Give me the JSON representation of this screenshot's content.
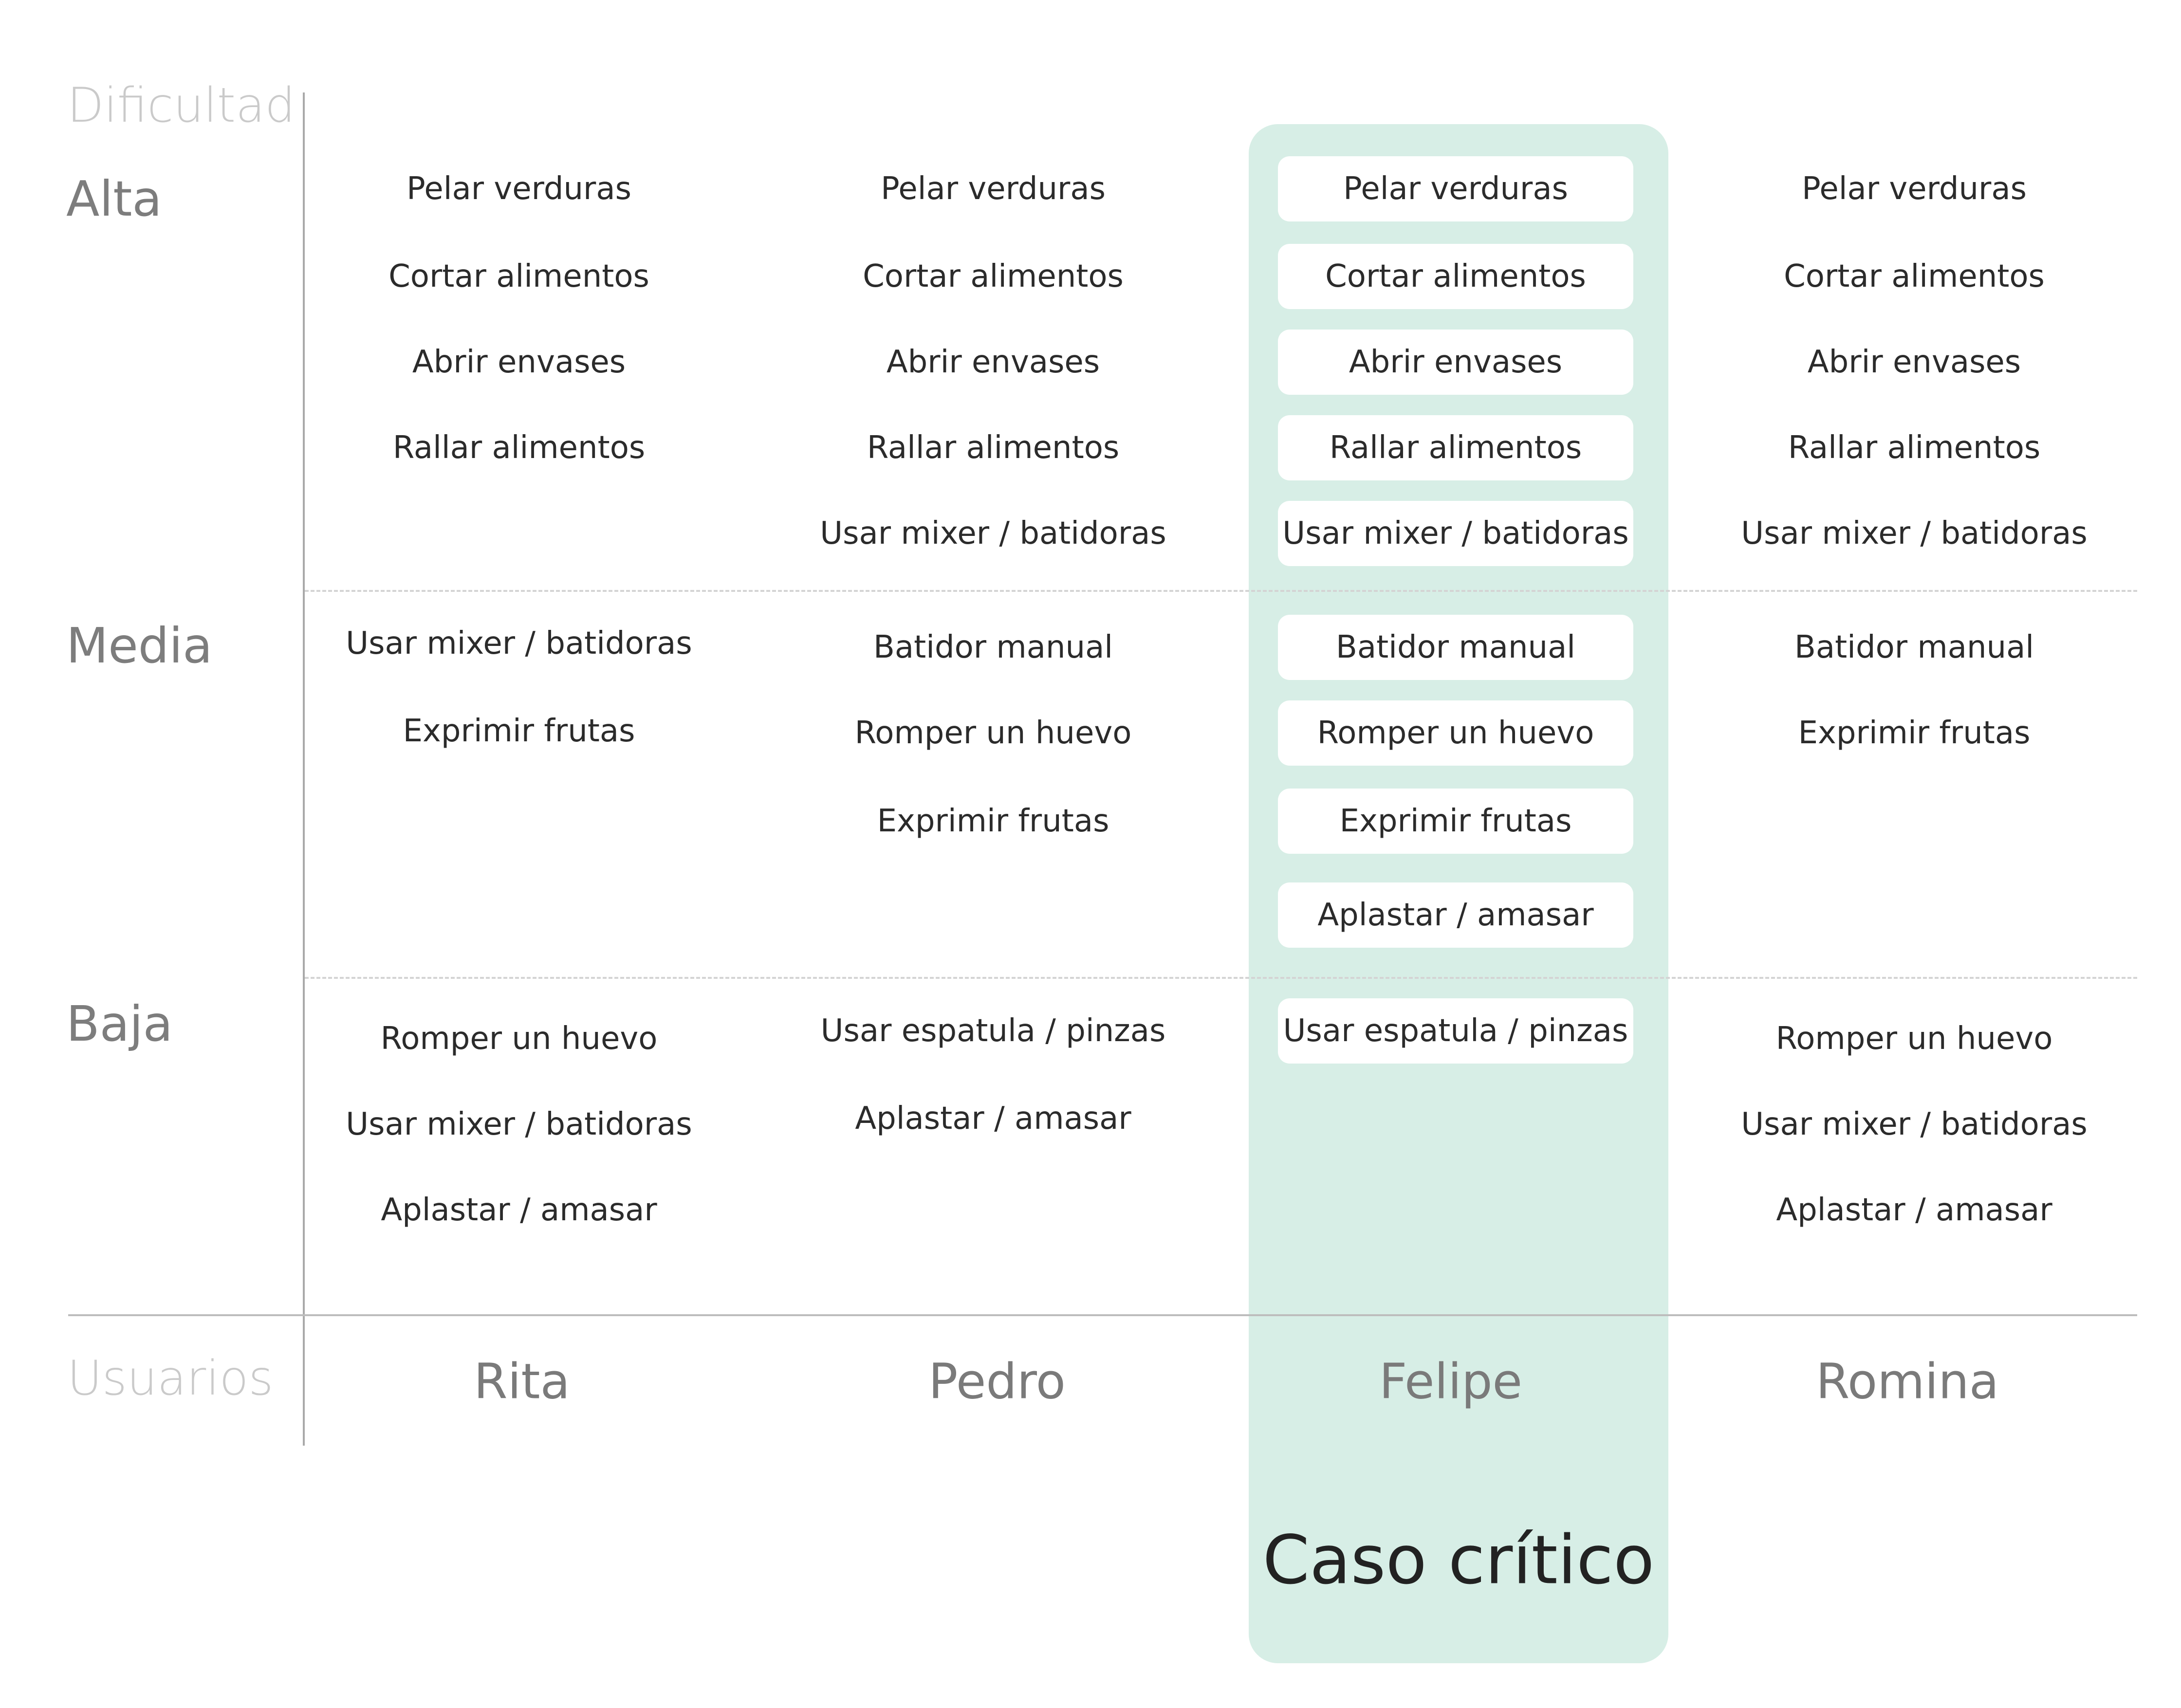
{
  "axes": {
    "y_title": "Dificultad",
    "x_title": "Usuarios"
  },
  "levels": [
    "Alta",
    "Media",
    "Baja"
  ],
  "users": [
    {
      "name": "Rita",
      "highlight": false,
      "tasks": {
        "alta": [
          "Pelar verduras",
          "Cortar alimentos",
          "Abrir envases",
          "Rallar alimentos"
        ],
        "media": [
          "Usar mixer / batidoras",
          "Exprimir frutas"
        ],
        "baja": [
          "Romper un huevo",
          "Usar mixer / batidoras",
          "Aplastar / amasar"
        ]
      }
    },
    {
      "name": "Pedro",
      "highlight": false,
      "tasks": {
        "alta": [
          "Pelar verduras",
          "Cortar alimentos",
          "Abrir envases",
          "Rallar alimentos",
          "Usar mixer / batidoras"
        ],
        "media": [
          "Batidor manual",
          "Romper un huevo",
          "Exprimir frutas"
        ],
        "baja": [
          "Usar espatula / pinzas",
          "Aplastar / amasar"
        ]
      }
    },
    {
      "name": "Felipe",
      "highlight": true,
      "tasks": {
        "alta": [
          "Pelar verduras",
          "Cortar alimentos",
          "Abrir envases",
          "Rallar alimentos",
          "Usar mixer / batidoras"
        ],
        "media": [
          "Batidor manual",
          "Romper un huevo",
          "Exprimir frutas",
          "Aplastar / amasar"
        ],
        "baja": [
          "Usar espatula / pinzas"
        ]
      }
    },
    {
      "name": "Romina",
      "highlight": false,
      "tasks": {
        "alta": [
          "Pelar verduras",
          "Cortar alimentos",
          "Abrir envases",
          "Rallar alimentos",
          "Usar mixer / batidoras"
        ],
        "media": [
          "Batidor manual",
          "Exprimir frutas"
        ],
        "baja": [
          "Romper un huevo",
          "Usar mixer / batidoras",
          "Aplastar / amasar"
        ]
      }
    }
  ],
  "critical_label": "Caso crítico",
  "colors": {
    "highlight_band": "#d7eee6",
    "task_box": "#ffffff"
  }
}
